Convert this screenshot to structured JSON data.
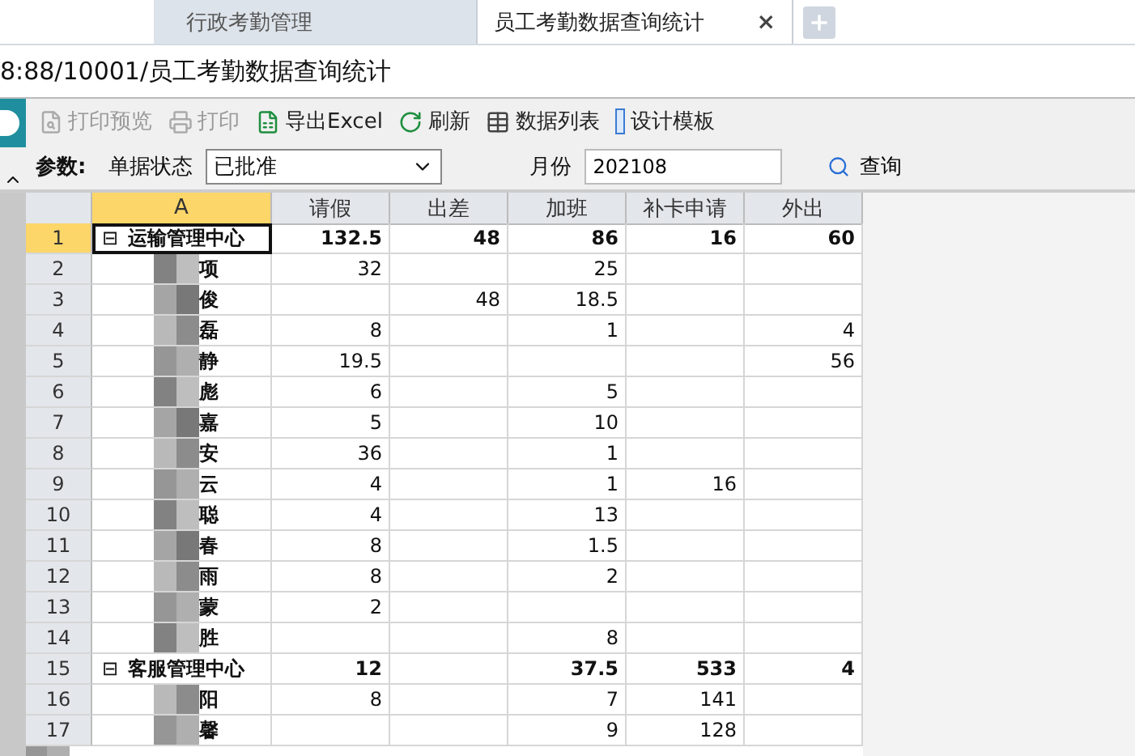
{
  "tabs": [
    {
      "label": "行政考勤管理",
      "selected": false
    },
    {
      "label": "员工考勤数据查询统计",
      "selected": true,
      "close": "×"
    }
  ],
  "address": "8:88/10001/员工考勤数据查询统计",
  "toolbar": [
    {
      "kind": "preview",
      "label": "打印预览",
      "disabled": true
    },
    {
      "kind": "print",
      "label": "打印",
      "disabled": true
    },
    {
      "kind": "excel",
      "label": "导出Excel",
      "disabled": false
    },
    {
      "kind": "refresh",
      "label": "刷新",
      "disabled": false
    },
    {
      "kind": "table",
      "label": "数据列表",
      "disabled": false
    },
    {
      "kind": "design",
      "label": "设计模板",
      "disabled": false
    }
  ],
  "params": {
    "title": "参数:",
    "status_label": "单据状态",
    "status_value": "已批准",
    "month_label": "月份",
    "month_value": "202108",
    "query": "查询"
  },
  "table": {
    "columns": [
      {
        "label": "A",
        "selected": true
      },
      {
        "label": "请假",
        "selected": false
      },
      {
        "label": "出差",
        "selected": false
      },
      {
        "label": "加班",
        "selected": false
      },
      {
        "label": "补卡申请",
        "selected": false
      },
      {
        "label": "外出",
        "selected": false
      }
    ],
    "rows": [
      {
        "num": "1",
        "selected": true,
        "kind": "group",
        "name": "运输管理中心",
        "expand": "⊟",
        "leave": "132.5",
        "trip": "48",
        "overtime": "86",
        "card": "16",
        "out": "60"
      },
      {
        "num": "2",
        "selected": false,
        "kind": "item",
        "name": "项",
        "leave": "32",
        "overtime": "25"
      },
      {
        "num": "3",
        "selected": false,
        "kind": "item",
        "name": "俊",
        "trip": "48",
        "overtime": "18.5"
      },
      {
        "num": "4",
        "selected": false,
        "kind": "item",
        "name": "磊",
        "leave": "8",
        "overtime": "1",
        "out": "4"
      },
      {
        "num": "5",
        "selected": false,
        "kind": "item",
        "name": "静",
        "leave": "19.5",
        "out": "56"
      },
      {
        "num": "6",
        "selected": false,
        "kind": "item",
        "name": "彪",
        "leave": "6",
        "overtime": "5"
      },
      {
        "num": "7",
        "selected": false,
        "kind": "item",
        "name": "嘉",
        "leave": "5",
        "overtime": "10"
      },
      {
        "num": "8",
        "selected": false,
        "kind": "item",
        "name": "安",
        "leave": "36",
        "overtime": "1"
      },
      {
        "num": "9",
        "selected": false,
        "kind": "item",
        "name": "云",
        "leave": "4",
        "overtime": "1",
        "card": "16"
      },
      {
        "num": "10",
        "selected": false,
        "kind": "item",
        "name": "聪",
        "leave": "4",
        "overtime": "13"
      },
      {
        "num": "11",
        "selected": false,
        "kind": "item",
        "name": "春",
        "leave": "8",
        "overtime": "1.5"
      },
      {
        "num": "12",
        "selected": false,
        "kind": "item",
        "name": "雨",
        "leave": "8",
        "overtime": "2"
      },
      {
        "num": "13",
        "selected": false,
        "kind": "item",
        "name": "蒙",
        "leave": "2"
      },
      {
        "num": "14",
        "selected": false,
        "kind": "item",
        "name": "胜",
        "overtime": "8"
      },
      {
        "num": "15",
        "selected": false,
        "kind": "group",
        "name": "客服管理中心",
        "expand": "⊟",
        "leave": "12",
        "overtime": "37.5",
        "card": "533",
        "out": "4"
      },
      {
        "num": "16",
        "selected": false,
        "kind": "item",
        "name": "阳",
        "leave": "8",
        "overtime": "7",
        "card": "141"
      },
      {
        "num": "17",
        "selected": false,
        "kind": "item",
        "name": "馨",
        "overtime": "9",
        "card": "128"
      }
    ]
  }
}
